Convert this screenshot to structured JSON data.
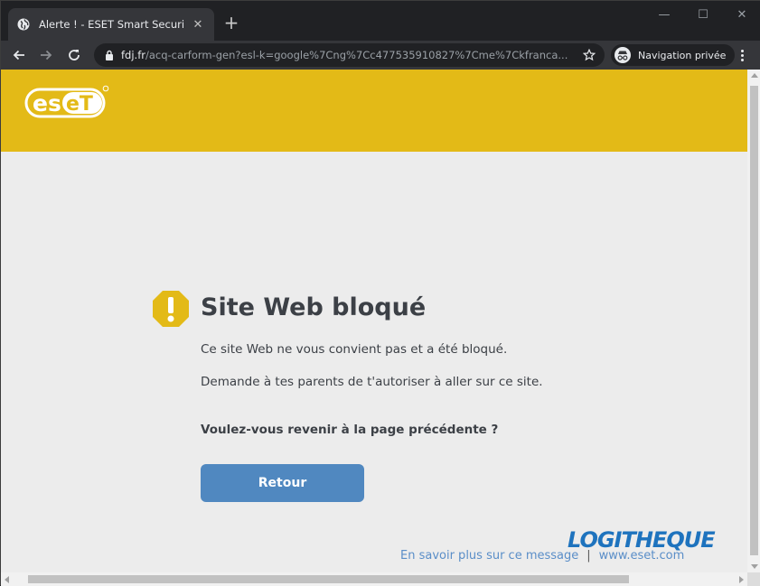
{
  "browser": {
    "tab": {
      "title": "Alerte ! - ESET Smart Security Pre",
      "favicon": "globe-icon",
      "close_label": "✕"
    },
    "new_tab_label": "+",
    "window_controls": {
      "minimize": "—",
      "maximize": "☐",
      "close": "✕"
    },
    "address_bar": {
      "host": "fdj.fr",
      "path": "/acq-carform-gen?esl-k=google%7Cng%7Cc477535910827%7Cme%7Ckfranca..."
    },
    "incognito_label": "Navigation privée"
  },
  "page": {
    "brand_color": "#e3ba17",
    "title": "Site Web bloqué",
    "message_1": "Ce site Web ne vous convient pas et a été bloqué.",
    "message_2": "Demande à tes parents de t'autoriser à aller sur ce site.",
    "question": "Voulez-vous revenir à la page précédente ?",
    "back_button_label": "Retour",
    "footer": {
      "learn_more": "En savoir plus sur ce message",
      "separator": "|",
      "site_link": "www.eset.com"
    },
    "watermark": "LOGITHEQUE"
  }
}
